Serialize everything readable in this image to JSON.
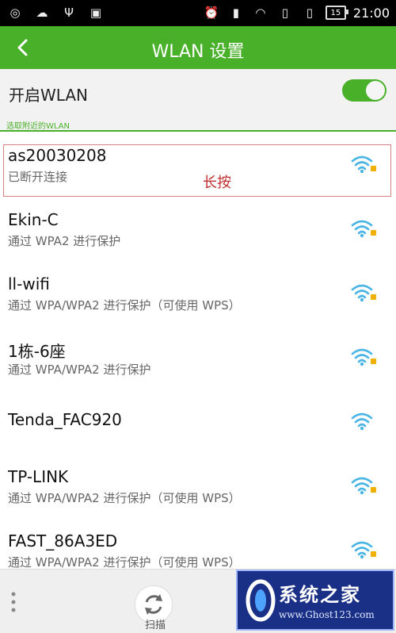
{
  "status_bar": {
    "time": "21:00",
    "battery": "15",
    "left_icons": [
      "screenshot-icon",
      "weather-icon",
      "usb-icon",
      "android-icon"
    ],
    "right_icons": [
      "alarm-icon",
      "sim-icon",
      "wifi-icon",
      "sim-icon",
      "sim-icon",
      "battery-icon"
    ]
  },
  "header": {
    "title": "WLAN 设置",
    "back_icon": "back-arrow-icon"
  },
  "wlan_toggle": {
    "label": "开启WLAN",
    "state": "on"
  },
  "hint": "选取附近的WLAN",
  "networks": [
    {
      "name": "as20030208",
      "status": "已断开连接",
      "secured": true
    },
    {
      "name": "Ekin-C",
      "status": "通过 WPA2 进行保护",
      "secured": true
    },
    {
      "name": "ll-wifi",
      "status": "通过 WPA/WPA2 进行保护（可使用 WPS）",
      "secured": true
    },
    {
      "name": "1栋-6座",
      "status": "通过 WPA/WPA2 进行保护",
      "secured": true
    },
    {
      "name": "Tenda_FAC920",
      "status": "",
      "secured": false
    },
    {
      "name": "TP-LINK",
      "status": "通过 WPA/WPA2 进行保护（可使用 WPS）",
      "secured": true
    },
    {
      "name": "FAST_86A3ED",
      "status": "通过 WPA/WPA2 进行保护（可使用 WPS）",
      "secured": true
    }
  ],
  "annotation": "长按",
  "bottom_bar": {
    "scan_label": "扫描"
  },
  "watermark": {
    "title": "系统之家",
    "url": "www.Ghost123.com"
  },
  "colors": {
    "accent": "#49b02a",
    "wifi": "#49b5e5",
    "lock": "#f0b000",
    "annotation": "#c03030"
  }
}
